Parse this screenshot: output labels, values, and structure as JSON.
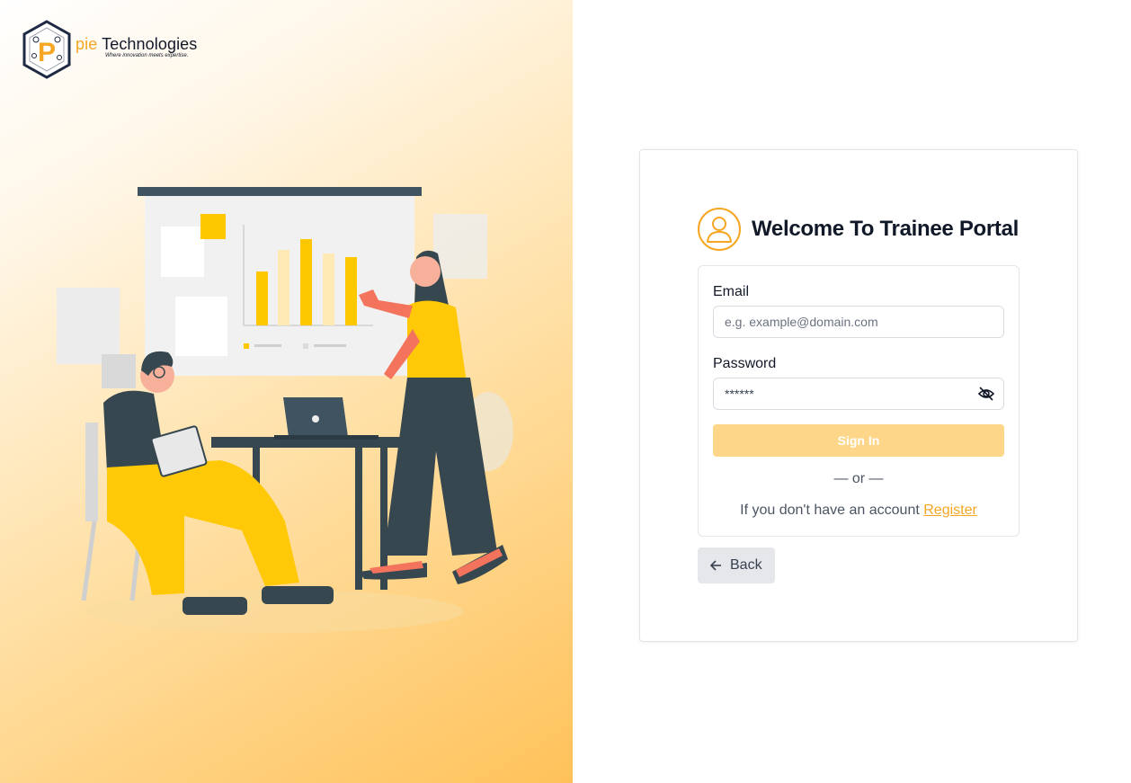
{
  "brand": {
    "logo_initial": "P",
    "name_accent": "pie",
    "name_rest": "Technologies",
    "tagline": "Where innovation meets expertise."
  },
  "login": {
    "title": "Welcome To Trainee Portal",
    "email_label": "Email",
    "email_placeholder": "e.g. example@domain.com",
    "password_label": "Password",
    "password_value": "******",
    "signin_label": "Sign In",
    "divider": "— or —",
    "register_prompt": "If you don't have an account",
    "register_link": "Register",
    "back_label": "Back"
  },
  "icons": {
    "avatar": "user-circle-icon",
    "password_toggle": "eye-slash-icon",
    "back": "arrow-left-icon"
  },
  "colors": {
    "accent": "#f5a623",
    "signin_button": "#fdd68a",
    "back_button": "#e5e7eb",
    "illustration_yellow": "#ffc907",
    "illustration_teal": "#37474f",
    "illustration_coral": "#f4735c"
  }
}
